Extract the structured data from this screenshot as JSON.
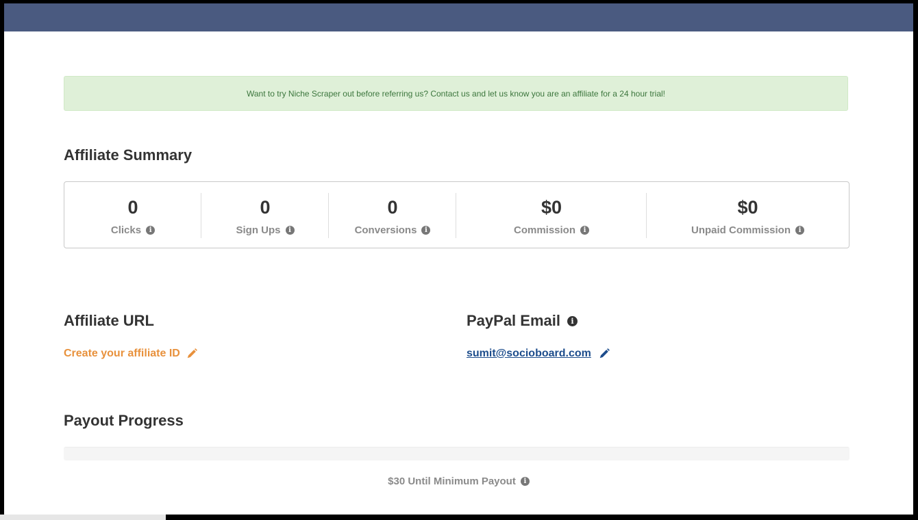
{
  "notice": {
    "text": "Want to try Niche Scraper out before referring us? Contact us and let us know you are an affiliate for a 24 hour trial!"
  },
  "summary": {
    "title": "Affiliate Summary",
    "stats": [
      {
        "value": "0",
        "label": "Clicks"
      },
      {
        "value": "0",
        "label": "Sign Ups"
      },
      {
        "value": "0",
        "label": "Conversions"
      },
      {
        "value": "$0",
        "label": "Commission"
      },
      {
        "value": "$0",
        "label": "Unpaid Commission"
      }
    ]
  },
  "affiliate_url": {
    "title": "Affiliate URL",
    "create_link": "Create your affiliate ID"
  },
  "paypal": {
    "title": "PayPal Email",
    "email": "sumit@socioboard.com"
  },
  "payout": {
    "title": "Payout Progress",
    "progress_fraction": 0,
    "status_text": "$30 Until Minimum Payout"
  },
  "colors": {
    "topbar": "#4a5a80",
    "notice_bg": "#dff0d8",
    "notice_text": "#3c763d",
    "link_orange": "#e8913c",
    "link_blue": "#1d4d8c"
  }
}
